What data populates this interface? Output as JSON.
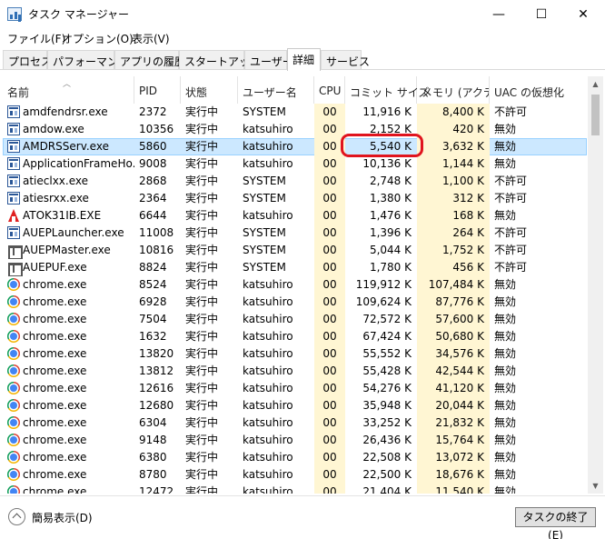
{
  "window": {
    "title": "タスク マネージャー",
    "minimize": "—",
    "maximize": "☐",
    "close": "✕"
  },
  "menu": [
    "ファイル(F)",
    "オプション(O)",
    "表示(V)"
  ],
  "tabs": [
    "プロセス",
    "パフォーマンス",
    "アプリの履歴",
    "スタートアップ",
    "ユーザー",
    "詳細",
    "サービス"
  ],
  "active_tab": "詳細",
  "columns": [
    "名前",
    "PID",
    "状態",
    "ユーザー名",
    "CPU",
    "コミット サイズ",
    "メモリ (アクテ...",
    "UAC の仮想化"
  ],
  "rows": [
    {
      "name": "amdfendrsr.exe",
      "icon": "window-icon",
      "pid": "2372",
      "status": "実行中",
      "user": "SYSTEM",
      "cpu": "00",
      "commit": "11,916 K",
      "memory": "8,400 K",
      "uac": "不許可"
    },
    {
      "name": "amdow.exe",
      "icon": "window-icon",
      "pid": "10356",
      "status": "実行中",
      "user": "katsuhiro",
      "cpu": "00",
      "commit": "2,152 K",
      "memory": "420 K",
      "uac": "無効"
    },
    {
      "name": "AMDRSServ.exe",
      "icon": "window-icon",
      "pid": "5860",
      "status": "実行中",
      "user": "katsuhiro",
      "cpu": "00",
      "commit": "5,540 K",
      "memory": "3,632 K",
      "uac": "無効",
      "selected": true
    },
    {
      "name": "ApplicationFrameHo...",
      "icon": "window-icon",
      "pid": "9008",
      "status": "実行中",
      "user": "katsuhiro",
      "cpu": "00",
      "commit": "10,136 K",
      "memory": "1,144 K",
      "uac": "無効"
    },
    {
      "name": "atieclxx.exe",
      "icon": "window-icon",
      "pid": "2868",
      "status": "実行中",
      "user": "SYSTEM",
      "cpu": "00",
      "commit": "2,748 K",
      "memory": "1,100 K",
      "uac": "不許可"
    },
    {
      "name": "atiesrxx.exe",
      "icon": "window-icon",
      "pid": "2364",
      "status": "実行中",
      "user": "SYSTEM",
      "cpu": "00",
      "commit": "1,380 K",
      "memory": "312 K",
      "uac": "不許可"
    },
    {
      "name": "ATOK31IB.EXE",
      "icon": "atok-icon",
      "pid": "6644",
      "status": "実行中",
      "user": "katsuhiro",
      "cpu": "00",
      "commit": "1,476 K",
      "memory": "168 K",
      "uac": "無効"
    },
    {
      "name": "AUEPLauncher.exe",
      "icon": "window-icon",
      "pid": "11008",
      "status": "実行中",
      "user": "SYSTEM",
      "cpu": "00",
      "commit": "1,396 K",
      "memory": "264 K",
      "uac": "不許可"
    },
    {
      "name": "AUEPMaster.exe",
      "icon": "service-icon",
      "pid": "10816",
      "status": "実行中",
      "user": "SYSTEM",
      "cpu": "00",
      "commit": "5,044 K",
      "memory": "1,752 K",
      "uac": "不許可"
    },
    {
      "name": "AUEPUF.exe",
      "icon": "service-icon",
      "pid": "8824",
      "status": "実行中",
      "user": "SYSTEM",
      "cpu": "00",
      "commit": "1,780 K",
      "memory": "456 K",
      "uac": "不許可"
    },
    {
      "name": "chrome.exe",
      "icon": "chrome-icon",
      "pid": "8524",
      "status": "実行中",
      "user": "katsuhiro",
      "cpu": "00",
      "commit": "119,912 K",
      "memory": "107,484 K",
      "uac": "無効"
    },
    {
      "name": "chrome.exe",
      "icon": "chrome-icon",
      "pid": "6928",
      "status": "実行中",
      "user": "katsuhiro",
      "cpu": "00",
      "commit": "109,624 K",
      "memory": "87,776 K",
      "uac": "無効"
    },
    {
      "name": "chrome.exe",
      "icon": "chrome-icon",
      "pid": "7504",
      "status": "実行中",
      "user": "katsuhiro",
      "cpu": "00",
      "commit": "72,572 K",
      "memory": "57,600 K",
      "uac": "無効"
    },
    {
      "name": "chrome.exe",
      "icon": "chrome-icon",
      "pid": "1632",
      "status": "実行中",
      "user": "katsuhiro",
      "cpu": "00",
      "commit": "67,424 K",
      "memory": "50,680 K",
      "uac": "無効"
    },
    {
      "name": "chrome.exe",
      "icon": "chrome-icon",
      "pid": "13820",
      "status": "実行中",
      "user": "katsuhiro",
      "cpu": "00",
      "commit": "55,552 K",
      "memory": "34,576 K",
      "uac": "無効"
    },
    {
      "name": "chrome.exe",
      "icon": "chrome-icon",
      "pid": "13812",
      "status": "実行中",
      "user": "katsuhiro",
      "cpu": "00",
      "commit": "55,428 K",
      "memory": "42,544 K",
      "uac": "無効"
    },
    {
      "name": "chrome.exe",
      "icon": "chrome-icon",
      "pid": "12616",
      "status": "実行中",
      "user": "katsuhiro",
      "cpu": "00",
      "commit": "54,276 K",
      "memory": "41,120 K",
      "uac": "無効"
    },
    {
      "name": "chrome.exe",
      "icon": "chrome-icon",
      "pid": "12680",
      "status": "実行中",
      "user": "katsuhiro",
      "cpu": "00",
      "commit": "35,948 K",
      "memory": "20,044 K",
      "uac": "無効"
    },
    {
      "name": "chrome.exe",
      "icon": "chrome-icon",
      "pid": "6304",
      "status": "実行中",
      "user": "katsuhiro",
      "cpu": "00",
      "commit": "33,252 K",
      "memory": "21,832 K",
      "uac": "無効"
    },
    {
      "name": "chrome.exe",
      "icon": "chrome-icon",
      "pid": "9148",
      "status": "実行中",
      "user": "katsuhiro",
      "cpu": "00",
      "commit": "26,436 K",
      "memory": "15,764 K",
      "uac": "無効"
    },
    {
      "name": "chrome.exe",
      "icon": "chrome-icon",
      "pid": "6380",
      "status": "実行中",
      "user": "katsuhiro",
      "cpu": "00",
      "commit": "22,508 K",
      "memory": "13,072 K",
      "uac": "無効"
    },
    {
      "name": "chrome.exe",
      "icon": "chrome-icon",
      "pid": "8780",
      "status": "実行中",
      "user": "katsuhiro",
      "cpu": "00",
      "commit": "22,500 K",
      "memory": "18,676 K",
      "uac": "無効"
    },
    {
      "name": "chrome.exe",
      "icon": "chrome-icon",
      "pid": "12472",
      "status": "実行中",
      "user": "katsuhiro",
      "cpu": "00",
      "commit": "21,404 K",
      "memory": "11,540 K",
      "uac": "無効"
    }
  ],
  "footer": {
    "fewer_details": "簡易表示(D)",
    "end_task": "タスクの終了(E)"
  },
  "colors": {
    "selected_row": "#cce8ff",
    "annotation": "#e0141e"
  }
}
